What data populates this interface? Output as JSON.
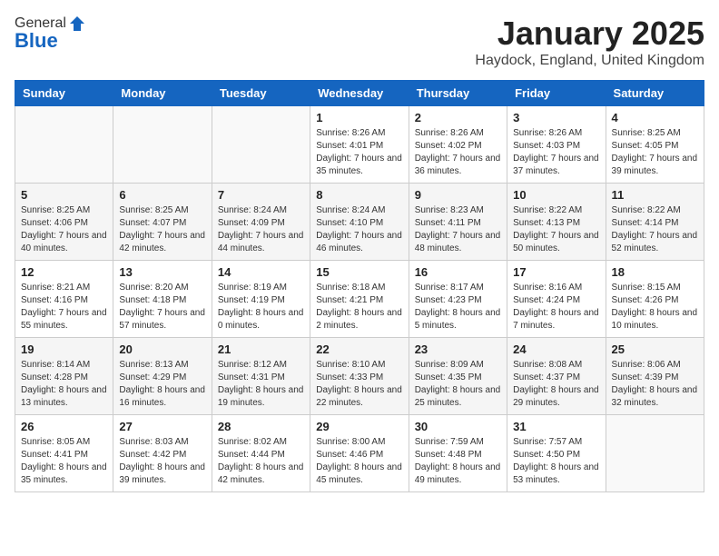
{
  "header": {
    "logo_general": "General",
    "logo_blue": "Blue",
    "month_title": "January 2025",
    "location": "Haydock, England, United Kingdom"
  },
  "weekdays": [
    "Sunday",
    "Monday",
    "Tuesday",
    "Wednesday",
    "Thursday",
    "Friday",
    "Saturday"
  ],
  "weeks": [
    [
      {
        "day": "",
        "info": ""
      },
      {
        "day": "",
        "info": ""
      },
      {
        "day": "",
        "info": ""
      },
      {
        "day": "1",
        "info": "Sunrise: 8:26 AM\nSunset: 4:01 PM\nDaylight: 7 hours and 35 minutes."
      },
      {
        "day": "2",
        "info": "Sunrise: 8:26 AM\nSunset: 4:02 PM\nDaylight: 7 hours and 36 minutes."
      },
      {
        "day": "3",
        "info": "Sunrise: 8:26 AM\nSunset: 4:03 PM\nDaylight: 7 hours and 37 minutes."
      },
      {
        "day": "4",
        "info": "Sunrise: 8:25 AM\nSunset: 4:05 PM\nDaylight: 7 hours and 39 minutes."
      }
    ],
    [
      {
        "day": "5",
        "info": "Sunrise: 8:25 AM\nSunset: 4:06 PM\nDaylight: 7 hours and 40 minutes."
      },
      {
        "day": "6",
        "info": "Sunrise: 8:25 AM\nSunset: 4:07 PM\nDaylight: 7 hours and 42 minutes."
      },
      {
        "day": "7",
        "info": "Sunrise: 8:24 AM\nSunset: 4:09 PM\nDaylight: 7 hours and 44 minutes."
      },
      {
        "day": "8",
        "info": "Sunrise: 8:24 AM\nSunset: 4:10 PM\nDaylight: 7 hours and 46 minutes."
      },
      {
        "day": "9",
        "info": "Sunrise: 8:23 AM\nSunset: 4:11 PM\nDaylight: 7 hours and 48 minutes."
      },
      {
        "day": "10",
        "info": "Sunrise: 8:22 AM\nSunset: 4:13 PM\nDaylight: 7 hours and 50 minutes."
      },
      {
        "day": "11",
        "info": "Sunrise: 8:22 AM\nSunset: 4:14 PM\nDaylight: 7 hours and 52 minutes."
      }
    ],
    [
      {
        "day": "12",
        "info": "Sunrise: 8:21 AM\nSunset: 4:16 PM\nDaylight: 7 hours and 55 minutes."
      },
      {
        "day": "13",
        "info": "Sunrise: 8:20 AM\nSunset: 4:18 PM\nDaylight: 7 hours and 57 minutes."
      },
      {
        "day": "14",
        "info": "Sunrise: 8:19 AM\nSunset: 4:19 PM\nDaylight: 8 hours and 0 minutes."
      },
      {
        "day": "15",
        "info": "Sunrise: 8:18 AM\nSunset: 4:21 PM\nDaylight: 8 hours and 2 minutes."
      },
      {
        "day": "16",
        "info": "Sunrise: 8:17 AM\nSunset: 4:23 PM\nDaylight: 8 hours and 5 minutes."
      },
      {
        "day": "17",
        "info": "Sunrise: 8:16 AM\nSunset: 4:24 PM\nDaylight: 8 hours and 7 minutes."
      },
      {
        "day": "18",
        "info": "Sunrise: 8:15 AM\nSunset: 4:26 PM\nDaylight: 8 hours and 10 minutes."
      }
    ],
    [
      {
        "day": "19",
        "info": "Sunrise: 8:14 AM\nSunset: 4:28 PM\nDaylight: 8 hours and 13 minutes."
      },
      {
        "day": "20",
        "info": "Sunrise: 8:13 AM\nSunset: 4:29 PM\nDaylight: 8 hours and 16 minutes."
      },
      {
        "day": "21",
        "info": "Sunrise: 8:12 AM\nSunset: 4:31 PM\nDaylight: 8 hours and 19 minutes."
      },
      {
        "day": "22",
        "info": "Sunrise: 8:10 AM\nSunset: 4:33 PM\nDaylight: 8 hours and 22 minutes."
      },
      {
        "day": "23",
        "info": "Sunrise: 8:09 AM\nSunset: 4:35 PM\nDaylight: 8 hours and 25 minutes."
      },
      {
        "day": "24",
        "info": "Sunrise: 8:08 AM\nSunset: 4:37 PM\nDaylight: 8 hours and 29 minutes."
      },
      {
        "day": "25",
        "info": "Sunrise: 8:06 AM\nSunset: 4:39 PM\nDaylight: 8 hours and 32 minutes."
      }
    ],
    [
      {
        "day": "26",
        "info": "Sunrise: 8:05 AM\nSunset: 4:41 PM\nDaylight: 8 hours and 35 minutes."
      },
      {
        "day": "27",
        "info": "Sunrise: 8:03 AM\nSunset: 4:42 PM\nDaylight: 8 hours and 39 minutes."
      },
      {
        "day": "28",
        "info": "Sunrise: 8:02 AM\nSunset: 4:44 PM\nDaylight: 8 hours and 42 minutes."
      },
      {
        "day": "29",
        "info": "Sunrise: 8:00 AM\nSunset: 4:46 PM\nDaylight: 8 hours and 45 minutes."
      },
      {
        "day": "30",
        "info": "Sunrise: 7:59 AM\nSunset: 4:48 PM\nDaylight: 8 hours and 49 minutes."
      },
      {
        "day": "31",
        "info": "Sunrise: 7:57 AM\nSunset: 4:50 PM\nDaylight: 8 hours and 53 minutes."
      },
      {
        "day": "",
        "info": ""
      }
    ]
  ]
}
